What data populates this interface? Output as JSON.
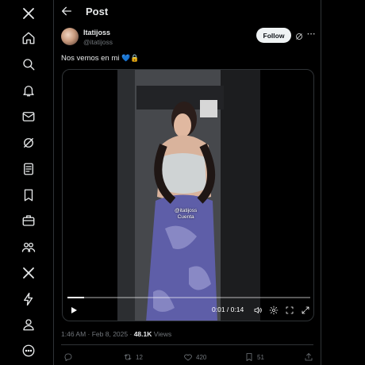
{
  "header": {
    "title": "Post"
  },
  "post": {
    "display_name": "Itatijoss",
    "handle": "@itatijoss",
    "follow_label": "Follow",
    "text": "Nos vemos en mi",
    "emojis": "💙🔒",
    "video": {
      "overlay_name": "@itatijoss",
      "overlay_sub": "Cuenta",
      "current_time": "0:01",
      "time_separator": "/",
      "duration": "0:14",
      "progress_fraction": 0.07
    },
    "timestamp": "1:46 AM · Feb 8, 2025",
    "dot": "·",
    "views_count": "48.1K",
    "views_label": "Views",
    "actions": {
      "replies": "",
      "reposts": "12",
      "likes": "420",
      "bookmarks": "51"
    }
  },
  "colors": {
    "background": "#000000",
    "text": "#e7e9ea",
    "muted": "#71767b",
    "border": "#2f3336",
    "follow_bg": "#eff3f4"
  }
}
